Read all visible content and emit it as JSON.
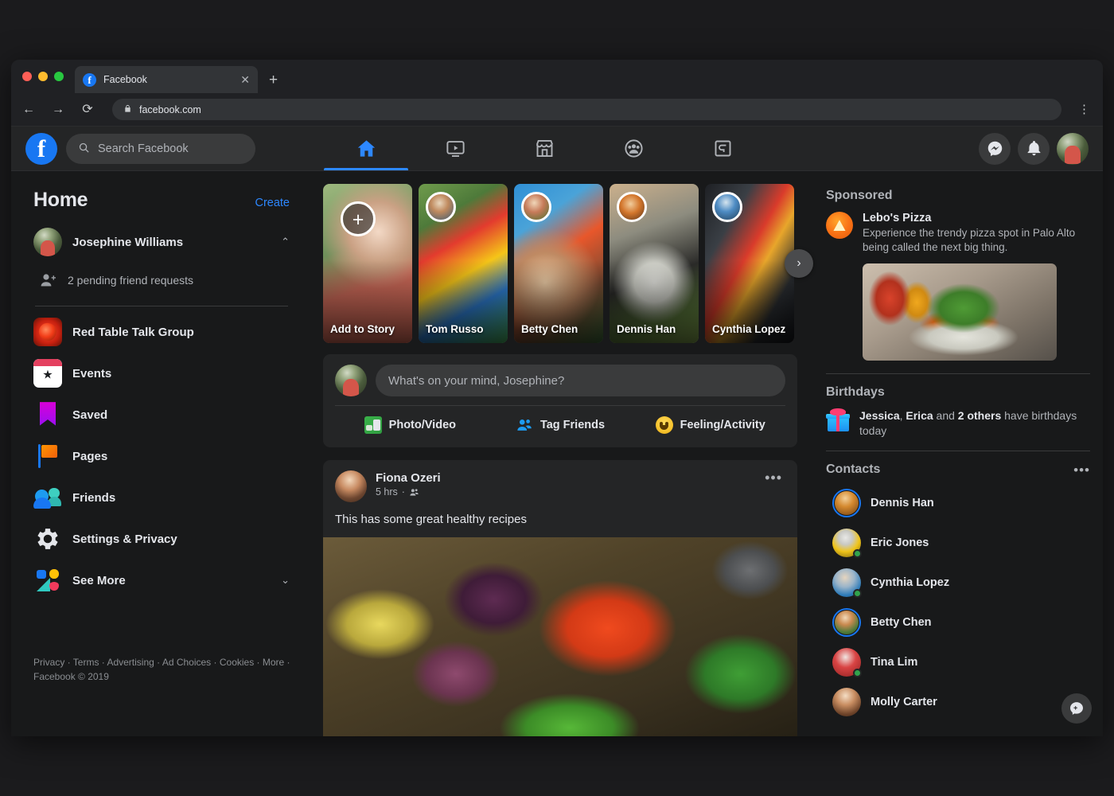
{
  "browser": {
    "tab_title": "Facebook",
    "tab_close": "✕",
    "new_tab": "+",
    "back": "←",
    "forward": "→",
    "reload": "⟳",
    "lock": "🔒",
    "url": "facebook.com",
    "menu": "⋮"
  },
  "topbar": {
    "logo": "f",
    "search_placeholder": "Search Facebook",
    "nav": [
      {
        "name": "home",
        "label": "Home",
        "active": true
      },
      {
        "name": "watch",
        "label": "Watch",
        "active": false
      },
      {
        "name": "marketplace",
        "label": "Marketplace",
        "active": false
      },
      {
        "name": "groups",
        "label": "Groups",
        "active": false
      },
      {
        "name": "gaming",
        "label": "Gaming",
        "active": false
      }
    ],
    "messenger": "messenger-icon",
    "notifications": "bell-icon",
    "avatar": "profile-avatar"
  },
  "sidebar": {
    "title": "Home",
    "create_label": "Create",
    "user_name": "Josephine Williams",
    "user_collapse": "⌃",
    "pending_requests": "2 pending friend requests",
    "items": [
      {
        "label": "Red Table Talk Group",
        "icon": "group-photo-icon"
      },
      {
        "label": "Events",
        "icon": "calendar-icon"
      },
      {
        "label": "Saved",
        "icon": "bookmark-icon"
      },
      {
        "label": "Pages",
        "icon": "flag-icon"
      },
      {
        "label": "Friends",
        "icon": "friends-icon"
      },
      {
        "label": "Settings & Privacy",
        "icon": "gear-icon"
      },
      {
        "label": "See More",
        "icon": "shapes-icon",
        "chevron": "⌄"
      }
    ],
    "footer": "Privacy · Terms · Advertising · Ad Choices · Cookies · More · Facebook © 2019"
  },
  "stories": {
    "next_arrow": "›",
    "add_plus": "+",
    "items": [
      {
        "label": "Add to Story",
        "type": "add"
      },
      {
        "label": "Tom Russo",
        "type": "story"
      },
      {
        "label": "Betty Chen",
        "type": "story"
      },
      {
        "label": "Dennis Han",
        "type": "story"
      },
      {
        "label": "Cynthia Lopez",
        "type": "story"
      }
    ]
  },
  "composer": {
    "placeholder": "What's on your mind, Josephine?",
    "actions": [
      {
        "label": "Photo/Video",
        "icon": "photo-video-icon"
      },
      {
        "label": "Tag Friends",
        "icon": "tag-friends-icon"
      },
      {
        "label": "Feeling/Activity",
        "icon": "feeling-activity-icon"
      }
    ]
  },
  "post": {
    "author": "Fiona Ozeri",
    "time": "5 hrs",
    "separator": "·",
    "audience": "friends-icon",
    "menu": "•••",
    "text": "This has some great healthy recipes",
    "image": "farmers-market-produce-photo"
  },
  "right": {
    "sponsored_title": "Sponsored",
    "ad": {
      "title": "Lebo's Pizza",
      "description": "Experience the trendy pizza spot in Palo Alto being called the next big thing.",
      "image": "pizza-salad-photo"
    },
    "birthdays_title": "Birthdays",
    "birthday": {
      "name1": "Jessica",
      "comma": ", ",
      "name2": "Erica",
      "and": " and ",
      "others": "2 others",
      "tail": " have birthdays today"
    },
    "contacts_title": "Contacts",
    "contacts_menu": "•••",
    "contacts": [
      {
        "name": "Dennis Han",
        "ring": true,
        "online": false
      },
      {
        "name": "Eric Jones",
        "ring": false,
        "online": true
      },
      {
        "name": "Cynthia Lopez",
        "ring": false,
        "online": true
      },
      {
        "name": "Betty Chen",
        "ring": true,
        "online": false
      },
      {
        "name": "Tina Lim",
        "ring": false,
        "online": true
      },
      {
        "name": "Molly Carter",
        "ring": false,
        "online": false
      }
    ],
    "new_message": "new-message-icon"
  },
  "colors": {
    "accent": "#2d88ff",
    "brand": "#1877f2",
    "card": "#242526",
    "page_bg": "#18191a",
    "online": "#31a24c"
  }
}
